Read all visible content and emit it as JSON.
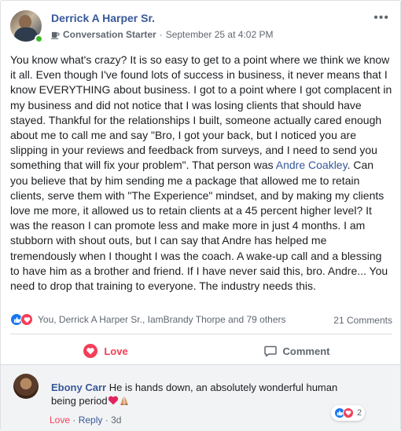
{
  "post": {
    "author": "Derrick A Harper Sr.",
    "badge": "Conversation Starter",
    "separator": "·",
    "timestamp": "September 25 at 4:02 PM",
    "more_label": "•••",
    "body_before_link": "You know what's crazy? It is so easy to get to a point where we think we know it all. Even though I've found lots of success in business, it never means that I know EVERYTHING about business. I got to a point where I got complacent in my business and did not notice that I was losing clients that should have stayed. Thankful for the relationships I built, someone actually cared enough about me to call me and say \"Bro, I got your back, but I noticed you are slipping in your reviews and feedback from surveys, and I need to send you something that will fix your problem\". That person was ",
    "body_link": "Andre Coakley",
    "body_after_link": ". Can you believe that by him sending me a package that allowed me to retain clients, serve them with \"The Experience\" mindset, and by making my clients love me more, it allowed us to retain clients at a 45 percent higher level? It was the reason I can promote less and make more in just 4 months. I am stubborn with shout outs, but I can say that Andre has helped me tremendously when I thought I was the coach. A wake-up call and a blessing to have him as a brother and friend. If I have never said this, bro. Andre... You need to drop that training to everyone. The industry needs this."
  },
  "stats": {
    "reactions_text": "You, Derrick A Harper Sr., IamBrandy Thorpe and 79 others",
    "comments_count": "21 Comments"
  },
  "actions": {
    "love_label": "Love",
    "comment_label": "Comment"
  },
  "comment": {
    "name": "Ebony Carr",
    "text": "He is hands down, an absolutely wonderful human being period",
    "reaction_count": "2",
    "love_link": "Love",
    "dot": "·",
    "reply_link": "Reply",
    "age": "3d"
  },
  "colors": {
    "link_blue": "#385898",
    "like_blue": "#1877f2",
    "love_red": "#f33e58",
    "online_green": "#42b72a"
  },
  "icons": [
    "more-icon",
    "mug-icon",
    "like-icon",
    "love-icon",
    "comment-icon",
    "heart-emoji-icon",
    "praying-hands-emoji-icon"
  ]
}
